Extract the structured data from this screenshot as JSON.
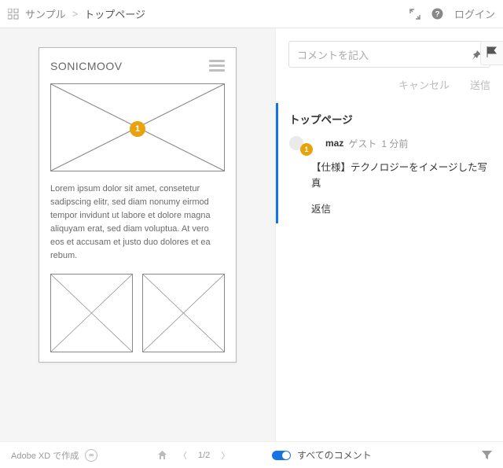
{
  "header": {
    "breadcrumb_parent": "サンプル",
    "breadcrumb_sep": ">",
    "breadcrumb_current": "トップページ",
    "login": "ログイン"
  },
  "artboard": {
    "title": "SONICMOOV",
    "badge": "1",
    "lorem": "Lorem ipsum dolor sit amet, consetetur sadipscing elitr, sed diam nonumy eirmod tempor invidunt ut labore et dolore magna aliquyam erat, sed diam voluptua. At vero eos et accusam et justo duo dolores et ea rebum."
  },
  "comments": {
    "placeholder": "コメントを記入",
    "cancel": "キャンセル",
    "send": "送信",
    "thread_title": "トップページ",
    "author": "maz",
    "role": "ゲスト",
    "time": "1 分前",
    "mini_badge": "1",
    "body": "【仕様】テクノロジーをイメージした写真",
    "reply": "返信"
  },
  "footer": {
    "made": "Adobe XD で作成",
    "page": "1/2",
    "filter_label": "すべてのコメント"
  }
}
